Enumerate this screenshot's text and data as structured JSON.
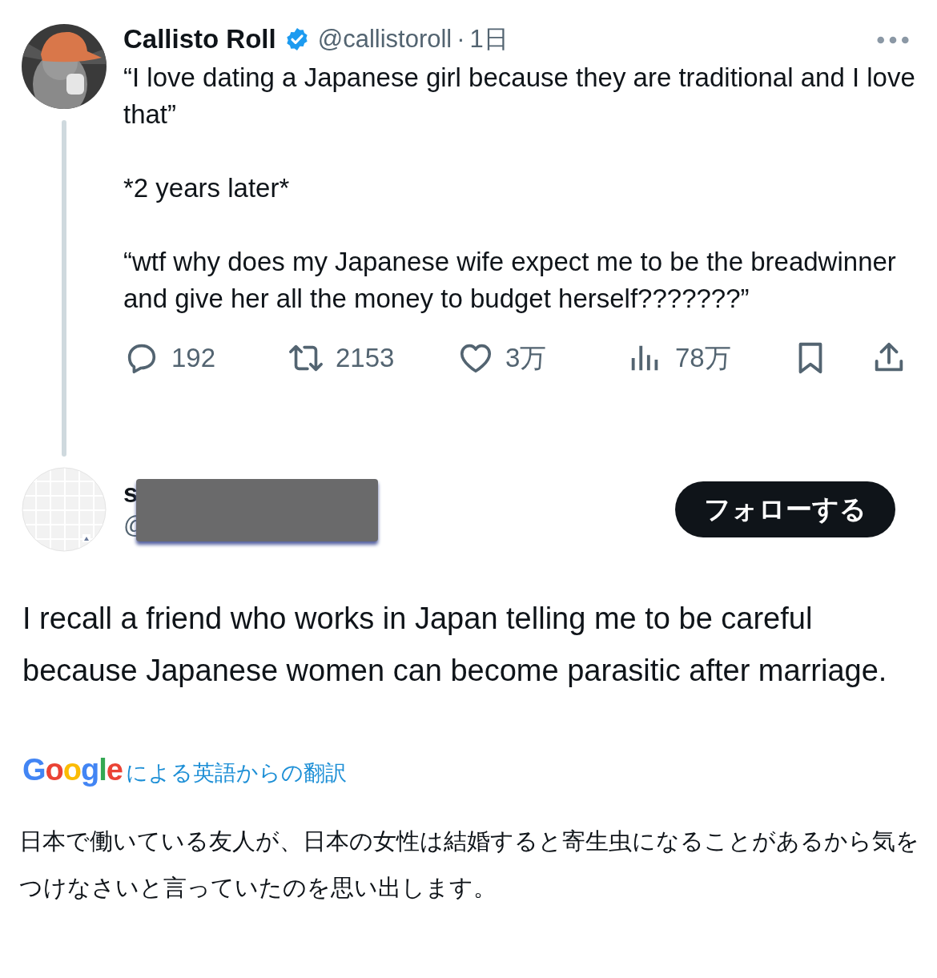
{
  "tweet": {
    "author": {
      "name": "Callisto Roll",
      "verified": true,
      "handle": "@callistoroll",
      "separator": "·",
      "time": "1日"
    },
    "paragraphs": [
      "“I love dating a Japanese girl because they are traditional and I love that”",
      "*2 years later*",
      "“wtf why does my Japanese wife expect me to be the breadwinner and give her all the money to budget herself???????”"
    ],
    "actions": [
      {
        "kind": "reply",
        "count": "192"
      },
      {
        "kind": "repost",
        "count": "2153"
      },
      {
        "kind": "like",
        "count": "3万"
      },
      {
        "kind": "views",
        "count": "78万"
      },
      {
        "kind": "bookmark"
      },
      {
        "kind": "share"
      }
    ]
  },
  "reply": {
    "author": {
      "name": "s",
      "handle": "@"
    },
    "redacted": true,
    "follow_button": "フォローする",
    "text": "I recall a friend who works in Japan telling me to be careful because Japanese women can become parasitic after marriage.",
    "translation_label": {
      "brand": "Google",
      "label": "による英語からの翻訳"
    },
    "translation": "日本で働いている友人が、日本の女性は結婚すると寄生虫になることがあるから気をつけなさいと言っていたのを思い出します。"
  }
}
